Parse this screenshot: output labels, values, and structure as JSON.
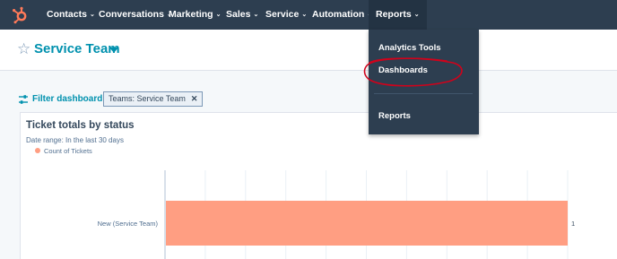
{
  "nav": {
    "items": [
      {
        "label": "Contacts"
      },
      {
        "label": "Conversations"
      },
      {
        "label": "Marketing"
      },
      {
        "label": "Sales"
      },
      {
        "label": "Service"
      },
      {
        "label": "Automation"
      },
      {
        "label": "Reports"
      }
    ],
    "caret": "⌄"
  },
  "reports_menu": {
    "items": [
      "Analytics Tools",
      "Dashboards",
      "Reports"
    ],
    "highlighted": "Dashboards"
  },
  "header": {
    "star": "☆",
    "title": "Service Team"
  },
  "filter": {
    "link": "Filter dashboard",
    "chip": "Teams: Service Team",
    "chip_close": "✕"
  },
  "card": {
    "title": "Ticket totals by status",
    "date_range": "Date range: In the last 30 days",
    "legend": "Count of Tickets"
  },
  "chart_data": {
    "type": "bar",
    "orientation": "horizontal",
    "categories": [
      "New (Service Team)"
    ],
    "series": [
      {
        "name": "Count of Tickets",
        "values": [
          1
        ]
      }
    ],
    "data_labels": [
      "1"
    ],
    "xlim": [
      0,
      1
    ],
    "grid": true,
    "legend_position": "top-left",
    "colors": {
      "bar": "#ff9e82"
    }
  },
  "colors": {
    "nav_bg": "#2d3e50",
    "accent": "#0091ae",
    "annotation": "#d0021b",
    "logo": "#ff7a59"
  }
}
